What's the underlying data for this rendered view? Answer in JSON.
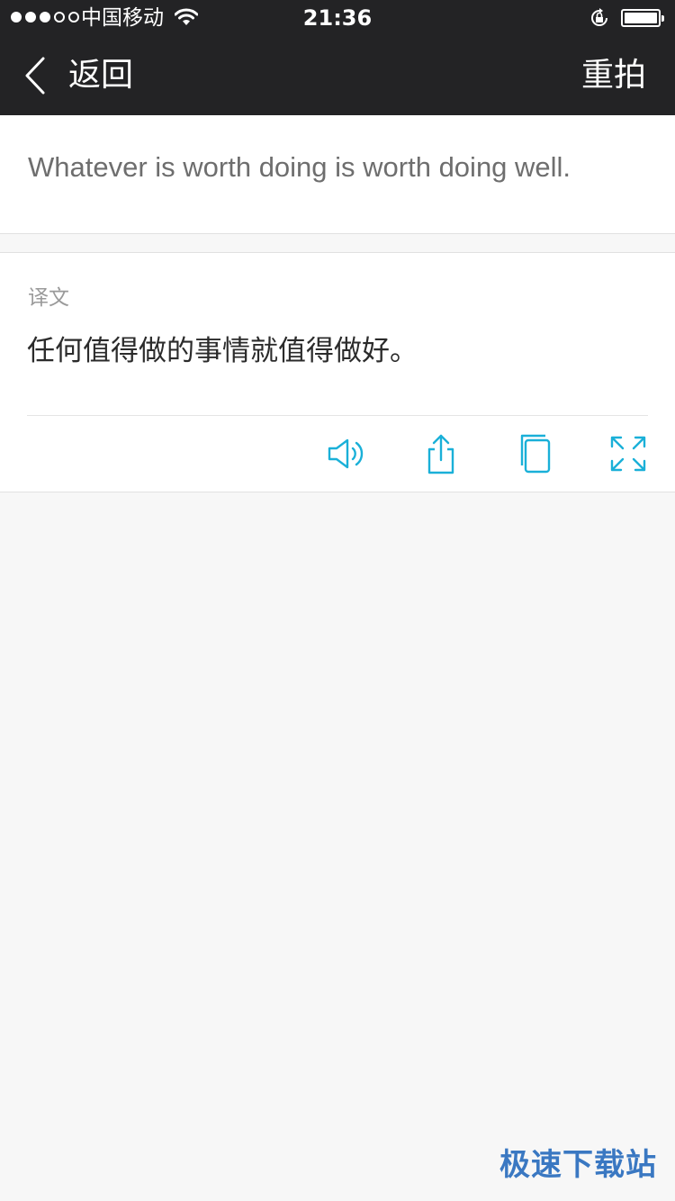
{
  "status_bar": {
    "carrier": "中国移动",
    "time": "21:36",
    "signal_bars_filled": 3,
    "signal_bars_total": 5,
    "icons": [
      "wifi-icon",
      "rotation-lock-icon",
      "battery-icon"
    ]
  },
  "nav": {
    "back_label": "返回",
    "back_icon": "chevron-left-icon",
    "retake_label": "重拍"
  },
  "source": {
    "text": "Whatever is worth doing is worth doing well."
  },
  "translation": {
    "label": "译文",
    "text": "任何值得做的事情就值得做好。"
  },
  "actions": [
    {
      "name": "speaker-icon"
    },
    {
      "name": "share-icon"
    },
    {
      "name": "copy-icon"
    },
    {
      "name": "fullscreen-icon"
    }
  ],
  "colors": {
    "nav_background": "#232325",
    "accent": "#1ab0d8",
    "page_background": "#f7f7f7",
    "watermark": "#3a78c2"
  },
  "watermark": "极速下载站"
}
